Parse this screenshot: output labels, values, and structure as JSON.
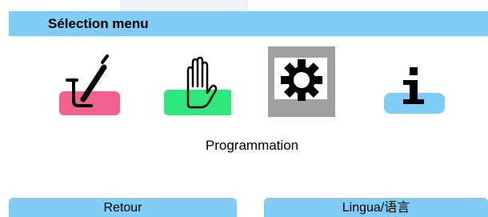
{
  "header": {
    "title": "Sélection menu"
  },
  "menu": {
    "items": [
      {
        "icon": "beaker-pen-icon",
        "bar_color": "#f2618f"
      },
      {
        "icon": "hand-icon",
        "bar_color": "#2ee87c"
      },
      {
        "icon": "gear-icon",
        "bar_color": "#a0a0a0",
        "selected": true
      },
      {
        "icon": "info-icon",
        "bar_color": "#7fcdf6"
      }
    ],
    "selected_label": "Programmation"
  },
  "softkeys": {
    "left_label": "Retour",
    "right_label": "Lingua/语言"
  },
  "colors": {
    "header": "#7fcdf6",
    "accent_pink": "#f2618f",
    "accent_green": "#2ee87c",
    "accent_blue": "#7fcdf6",
    "selection_gray": "#a0a0a0"
  }
}
